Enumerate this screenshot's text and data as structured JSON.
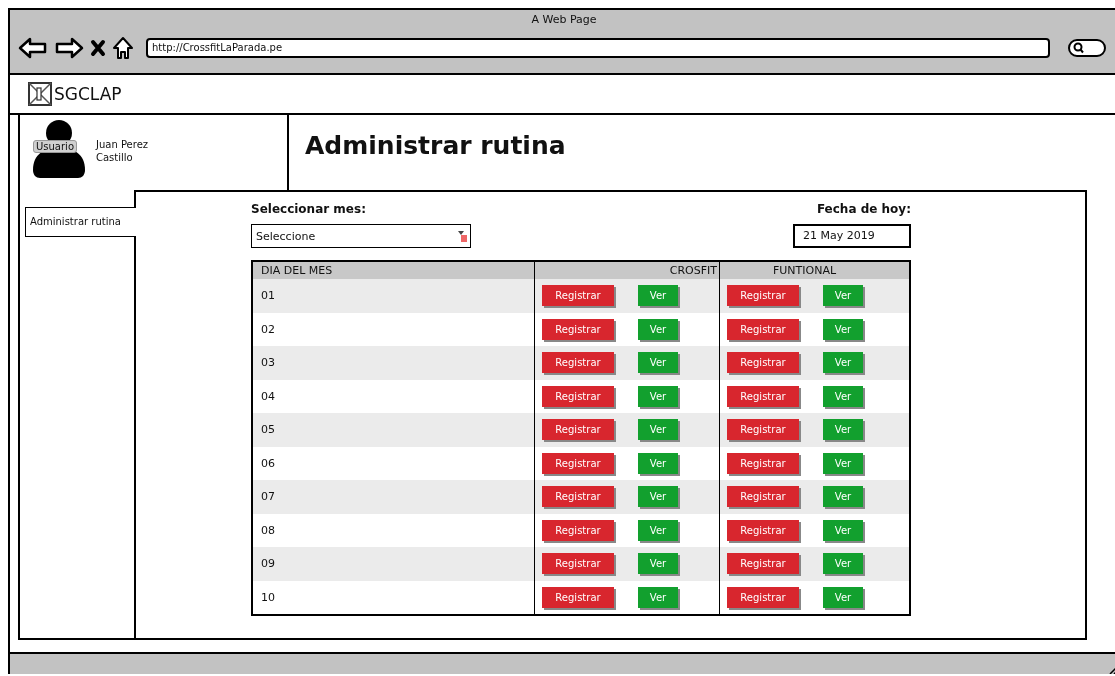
{
  "window": {
    "title": "A Web Page"
  },
  "address_bar": {
    "value": "http://CrossfitLaParada.pe"
  },
  "app": {
    "name": "SGCLAP"
  },
  "user": {
    "avatar_label": "Usuario",
    "name": "Juan Perez Castillo"
  },
  "sidebar": {
    "items": [
      {
        "label": "Administrar rutina",
        "selected": true
      }
    ]
  },
  "page": {
    "title": "Administrar rutina"
  },
  "month_select": {
    "label": "Seleccionar mes:",
    "value": "Seleccione"
  },
  "today": {
    "label": "Fecha de hoy:",
    "value": "21 May 2019"
  },
  "table": {
    "columns": [
      "DIA DEL MES",
      "CROSFIT",
      "FUNTIONAL"
    ],
    "rows": [
      {
        "day": "01",
        "cells": [
          {
            "register": "Registrar",
            "view": "Ver"
          },
          {
            "register": "Registrar",
            "view": "Ver"
          }
        ]
      },
      {
        "day": "02",
        "cells": [
          {
            "register": "Registrar",
            "view": "Ver"
          },
          {
            "register": "Registrar",
            "view": "Ver"
          }
        ]
      },
      {
        "day": "03",
        "cells": [
          {
            "register": "Registrar",
            "view": "Ver"
          },
          {
            "register": "Registrar",
            "view": "Ver"
          }
        ]
      },
      {
        "day": "04",
        "cells": [
          {
            "register": "Registrar",
            "view": "Ver"
          },
          {
            "register": "Registrar",
            "view": "Ver"
          }
        ]
      },
      {
        "day": "05",
        "cells": [
          {
            "register": "Registrar",
            "view": "Ver"
          },
          {
            "register": "Registrar",
            "view": "Ver"
          }
        ]
      },
      {
        "day": "06",
        "cells": [
          {
            "register": "Registrar",
            "view": "Ver"
          },
          {
            "register": "Registrar",
            "view": "Ver"
          }
        ]
      },
      {
        "day": "07",
        "cells": [
          {
            "register": "Registrar",
            "view": "Ver"
          },
          {
            "register": "Registrar",
            "view": "Ver"
          }
        ]
      },
      {
        "day": "08",
        "cells": [
          {
            "register": "Registrar",
            "view": "Ver"
          },
          {
            "register": "Registrar",
            "view": "Ver"
          }
        ]
      },
      {
        "day": "09",
        "cells": [
          {
            "register": "Registrar",
            "view": "Ver"
          },
          {
            "register": "Registrar",
            "view": "Ver"
          }
        ]
      },
      {
        "day": "10",
        "cells": [
          {
            "register": "Registrar",
            "view": "Ver"
          },
          {
            "register": "Registrar",
            "view": "Ver"
          }
        ]
      }
    ]
  }
}
